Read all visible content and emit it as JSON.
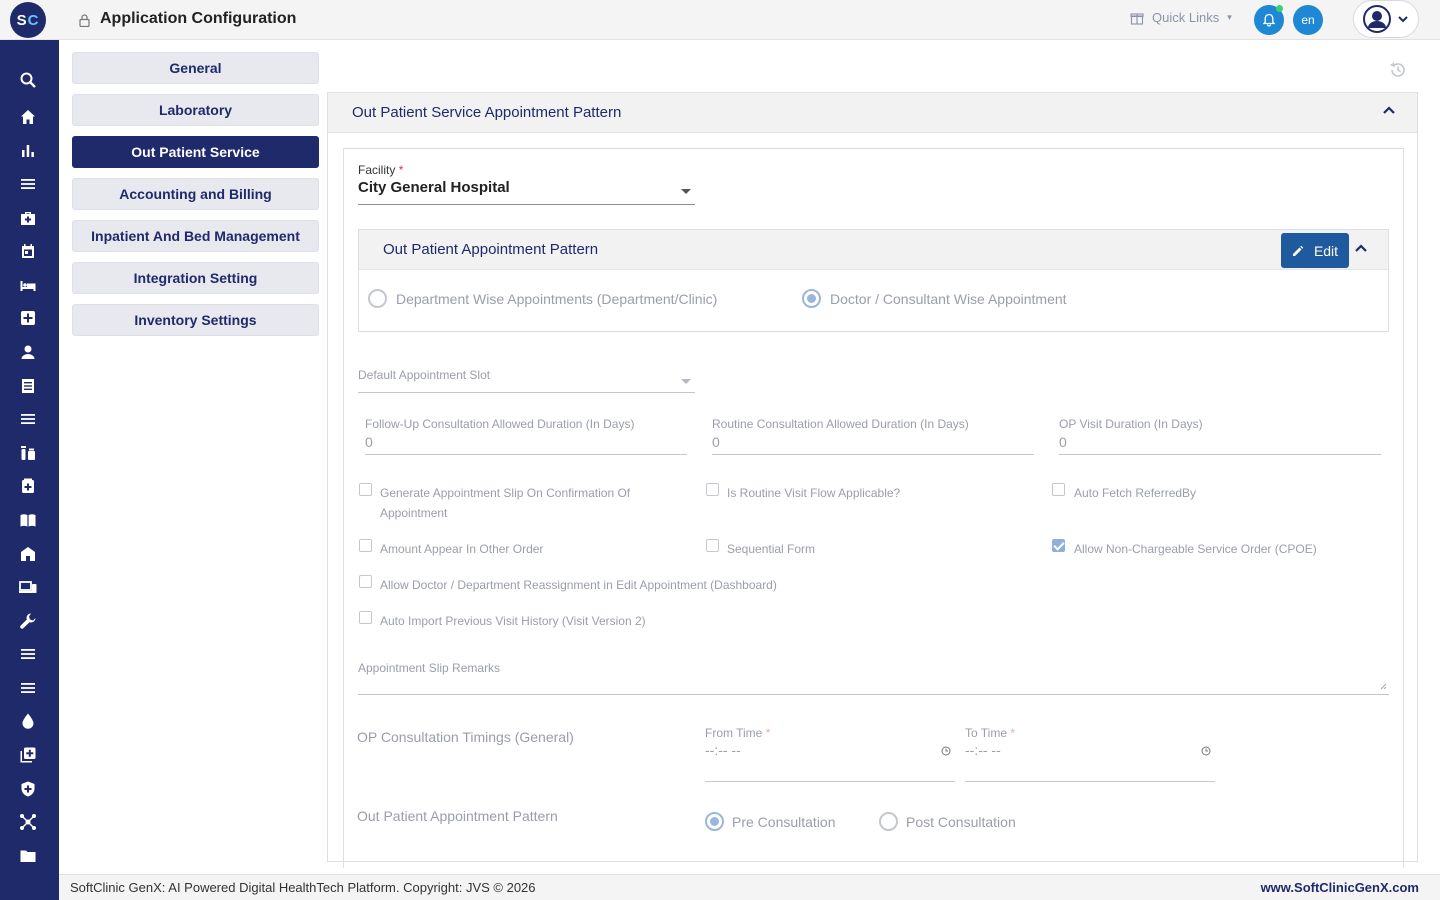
{
  "header": {
    "logo_text_1": "S",
    "logo_text_2": "C",
    "title": "Application Configuration",
    "quick_links": "Quick Links",
    "language": "en"
  },
  "menu": {
    "items": [
      {
        "label": "General"
      },
      {
        "label": "Laboratory"
      },
      {
        "label": "Out Patient Service"
      },
      {
        "label": "Accounting and Billing"
      },
      {
        "label": "Inpatient And Bed Management"
      },
      {
        "label": "Integration Setting"
      },
      {
        "label": "Inventory Settings"
      }
    ],
    "active": "Out Patient Service"
  },
  "section": {
    "title": "Out Patient Service Appointment Pattern",
    "facility_label": "Facility",
    "facility_required": "*",
    "facility_value": "City General Hospital",
    "pattern_card": {
      "title": "Out Patient Appointment Pattern",
      "edit_label": "Edit",
      "options": [
        {
          "label": "Department Wise Appointments (Department/Clinic)",
          "selected": false
        },
        {
          "label": "Doctor / Consultant Wise Appointment",
          "selected": true
        }
      ]
    },
    "default_slot_label": "Default Appointment Slot",
    "durations": [
      {
        "label": "Follow-Up Consultation Allowed Duration (In Days)",
        "value": "0"
      },
      {
        "label": "Routine Consultation Allowed Duration (In Days)",
        "value": "0"
      },
      {
        "label": "OP Visit Duration (In Days)",
        "value": "0"
      }
    ],
    "checkboxes": {
      "generate_slip_line1": "Generate Appointment Slip On Confirmation Of",
      "generate_slip_line2": "Appointment",
      "routine_visit": "Is Routine Visit Flow Applicable?",
      "auto_fetch": "Auto Fetch ReferredBy",
      "amount_other_order": "Amount Appear In Other Order",
      "sequential_form": "Sequential Form",
      "non_chargeable": "Allow Non-Chargeable Service Order (CPOE)",
      "non_chargeable_checked": true,
      "reassignment": "Allow Doctor / Department Reassignment in Edit Appointment (Dashboard)",
      "auto_import": "Auto Import Previous Visit History (Visit Version 2)"
    },
    "remarks_label": "Appointment Slip Remarks",
    "timings": {
      "label": "OP Consultation Timings (General)",
      "from_label": "From Time",
      "to_label": "To Time",
      "required": "*",
      "from_placeholder": "--:-- --",
      "to_placeholder": "--:-- --"
    },
    "op_pattern": {
      "label": "Out Patient Appointment Pattern",
      "options": [
        {
          "label": "Pre Consultation",
          "selected": true
        },
        {
          "label": "Post Consultation",
          "selected": false
        }
      ]
    }
  },
  "footer": {
    "copyright": "SoftClinic GenX: AI Powered Digital HealthTech Platform. Copyright: JVS © 2026",
    "site": "www.SoftClinicGenX.com"
  },
  "colors": {
    "brand": "#1f2a6b",
    "accent": "#1e88d4",
    "edit_button": "#1f5a9e"
  }
}
